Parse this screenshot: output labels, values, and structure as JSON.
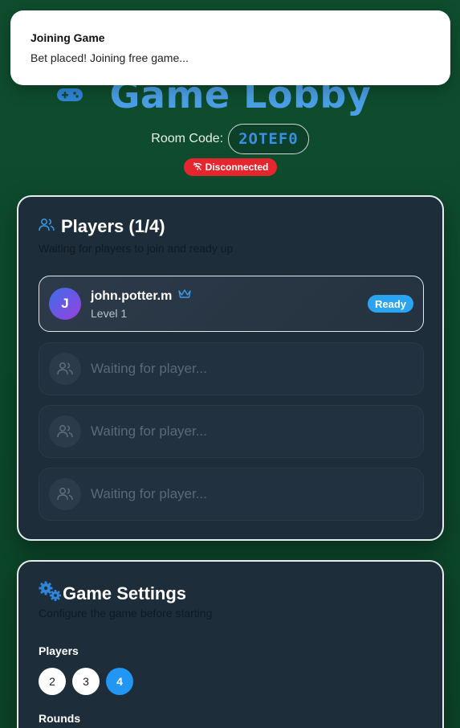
{
  "toast": {
    "title": "Joining Game",
    "message": "Bet placed! Joining free game..."
  },
  "header": {
    "title": "Game Lobby",
    "room_label": "Room Code:",
    "room_code": "2OTEF0",
    "connection_status": "Disconnected"
  },
  "players": {
    "title": "Players (1/4)",
    "subtitle": "Waiting for players to join and ready up",
    "list": [
      {
        "initial": "J",
        "name": "john.potter.m",
        "level": "Level 1",
        "status": "Ready"
      }
    ],
    "empty_slots": [
      "Waiting for player...",
      "Waiting for player...",
      "Waiting for player..."
    ]
  },
  "settings": {
    "title": "Game Settings",
    "subtitle": "Configure the game before starting",
    "players_label": "Players",
    "player_options": [
      "2",
      "3",
      "4"
    ],
    "selected_players": "4",
    "rounds_label": "Rounds"
  },
  "colors": {
    "background": "#0f4d2e",
    "accent": "#2196f3",
    "title": "#4b9fe6",
    "disconnected": "#e5262f"
  }
}
